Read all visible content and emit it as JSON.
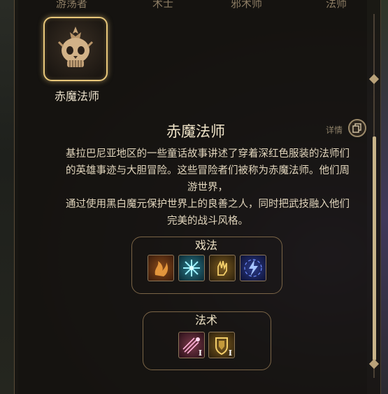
{
  "top_tabs": [
    "游荡者",
    "术士",
    "邪术师",
    "法师"
  ],
  "selected_subclass": {
    "label": "赤魔法师",
    "icon": "skull-crest-icon"
  },
  "title": "赤魔法师",
  "detail": {
    "label": "详情",
    "icon": "copy-icon"
  },
  "description": {
    "lines": [
      "基拉巴尼亚地区的一些童话故事讲述了穿着深红色服装的法师们",
      "的英雄事迹与大胆冒险。这些冒险者们被称为赤魔法师。他们周",
      "游世界，",
      "通过使用黑白魔元保护世界上的良善之人，同时把武技融入他们",
      "完美的战斗风格。"
    ]
  },
  "cantrips": {
    "title": "戏法",
    "items": [
      {
        "icon": "fire-hand-icon"
      },
      {
        "icon": "frost-star-icon"
      },
      {
        "icon": "mage-hand-icon"
      },
      {
        "icon": "lightning-swirl-icon"
      }
    ]
  },
  "spells": {
    "title": "法术",
    "items": [
      {
        "icon": "magic-missile-icon",
        "rank": "I"
      },
      {
        "icon": "shield-armor-icon",
        "rank": "I"
      }
    ]
  },
  "colors": {
    "accent": "#e8c77a",
    "text": "#e2d6bd",
    "frame": "#7a6446"
  }
}
